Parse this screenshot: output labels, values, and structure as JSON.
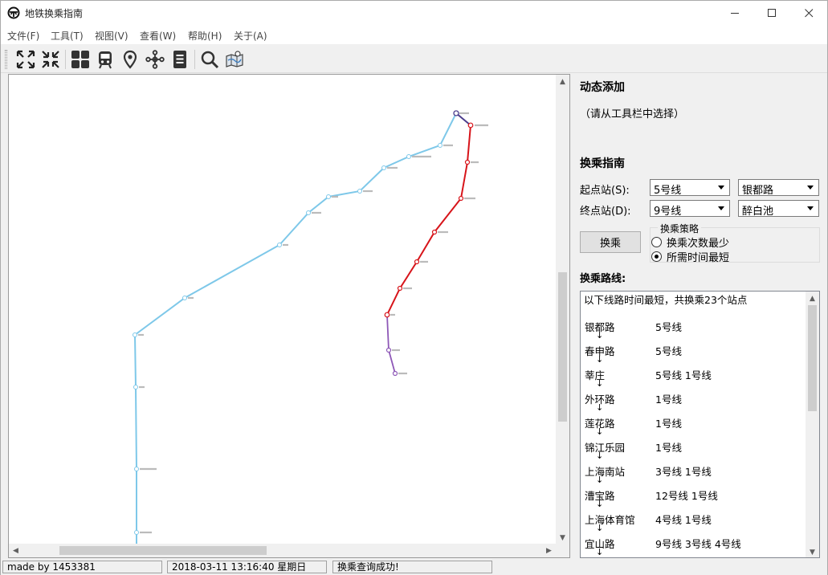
{
  "window": {
    "title": "地铁换乘指南"
  },
  "menu": [
    {
      "label": "文件(F)"
    },
    {
      "label": "工具(T)"
    },
    {
      "label": "视图(V)"
    },
    {
      "label": "查看(W)"
    },
    {
      "label": "帮助(H)"
    },
    {
      "label": "关于(A)"
    }
  ],
  "toolbar": {
    "buttons": [
      "expand-icon",
      "collapse-icon",
      "grid-icon",
      "train-icon",
      "location-pin-icon",
      "network-icon",
      "document-icon",
      "search-icon",
      "map-icon"
    ]
  },
  "map": {
    "colors": {
      "line_blue": "#7ec8e9",
      "line_red": "#d7141a",
      "line_purple": "#8e58b7",
      "line_dark": "#4b3c8c"
    }
  },
  "panel": {
    "dynamic_add_title": "动态添加",
    "dynamic_add_hint": "（请从工具栏中选择）",
    "guide_title": "换乘指南",
    "start_label": "起点站(S):",
    "end_label": "终点站(D):",
    "start_line": "5号线",
    "start_station": "银都路",
    "end_line": "9号线",
    "end_station": "醉白池",
    "transfer_button": "换乘",
    "strategy_title": "换乘策略",
    "strategy_options": [
      {
        "label": "换乘次数最少",
        "selected": false
      },
      {
        "label": "所需时间最短",
        "selected": true
      }
    ],
    "route_title": "换乘路线:",
    "route_summary": "以下线路时间最短，共换乘23个站点",
    "arrow": "↓",
    "route_stops": [
      {
        "name": "银都路",
        "lines": "5号线"
      },
      {
        "name": "春申路",
        "lines": "5号线"
      },
      {
        "name": "莘庄",
        "lines": "5号线  1号线"
      },
      {
        "name": "外环路",
        "lines": "1号线"
      },
      {
        "name": "莲花路",
        "lines": "1号线"
      },
      {
        "name": "锦江乐园",
        "lines": "1号线"
      },
      {
        "name": "上海南站",
        "lines": "3号线  1号线"
      },
      {
        "name": "漕宝路",
        "lines": "12号线  1号线"
      },
      {
        "name": "上海体育馆",
        "lines": "4号线  1号线"
      },
      {
        "name": "宜山路",
        "lines": "9号线  3号线  4号线"
      }
    ]
  },
  "status": {
    "author": "made by 1453381",
    "datetime": "2018-03-11 13:16:40 星期日",
    "message": "换乘查询成功!"
  }
}
